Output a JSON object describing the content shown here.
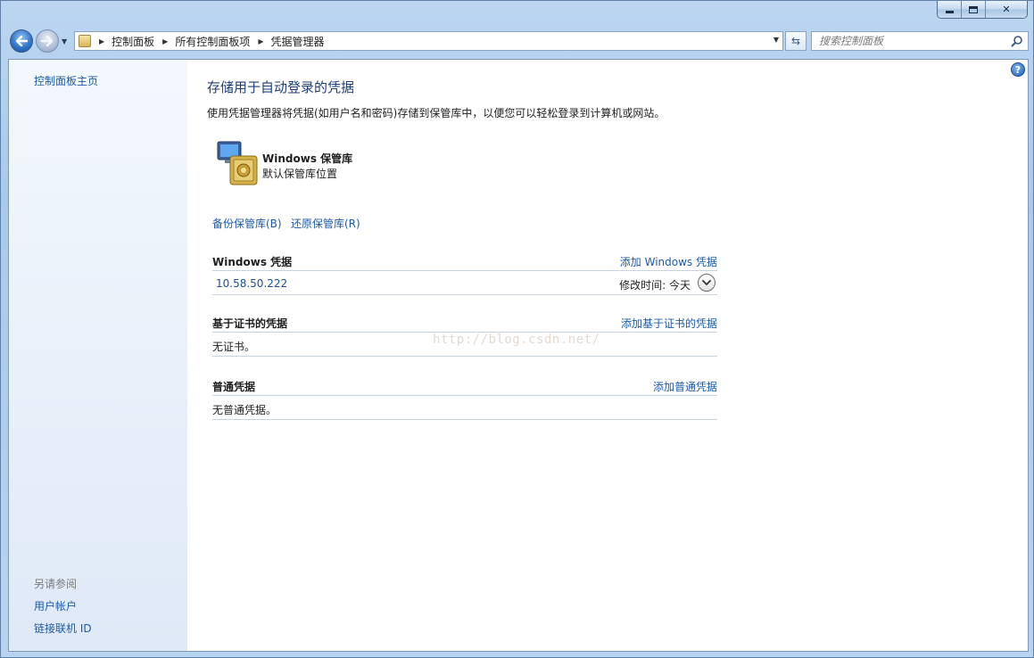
{
  "window": {
    "minimize_label": "minimize",
    "maximize_label": "maximize",
    "close_label": "close"
  },
  "navigation": {
    "breadcrumbs": [
      "控制面板",
      "所有控制面板项",
      "凭据管理器"
    ],
    "search_placeholder": "搜索控制面板"
  },
  "sidebar": {
    "home_label": "控制面板主页",
    "see_also_label": "另请参阅",
    "links": [
      "用户帐户",
      "链接联机 ID"
    ]
  },
  "main": {
    "title": "存储用于自动登录的凭据",
    "description": "使用凭据管理器将凭据(如用户名和密码)存储到保管库中，以便您可以轻松登录到计算机或网站。",
    "vault": {
      "name": "Windows 保管库",
      "subtitle": "默认保管库位置"
    },
    "backup_link": "备份保管库(B)",
    "restore_link": "还原保管库(R)",
    "sections": {
      "windows": {
        "title": "Windows 凭据",
        "add_link": "添加 Windows 凭据",
        "item": {
          "name": "10.58.50.222",
          "modified": "修改时间:  今天"
        }
      },
      "certificate": {
        "title": "基于证书的凭据",
        "add_link": "添加基于证书的凭据",
        "empty_text": "无证书。"
      },
      "generic": {
        "title": "普通凭据",
        "add_link": "添加普通凭据",
        "empty_text": "无普通凭据。"
      }
    }
  },
  "watermark": "http://blog.csdn.net/",
  "colors": {
    "link": "#1c5aa8",
    "title": "#1e3f75",
    "sidebar_link": "#1e3c66",
    "divider": "#c9d3de"
  }
}
